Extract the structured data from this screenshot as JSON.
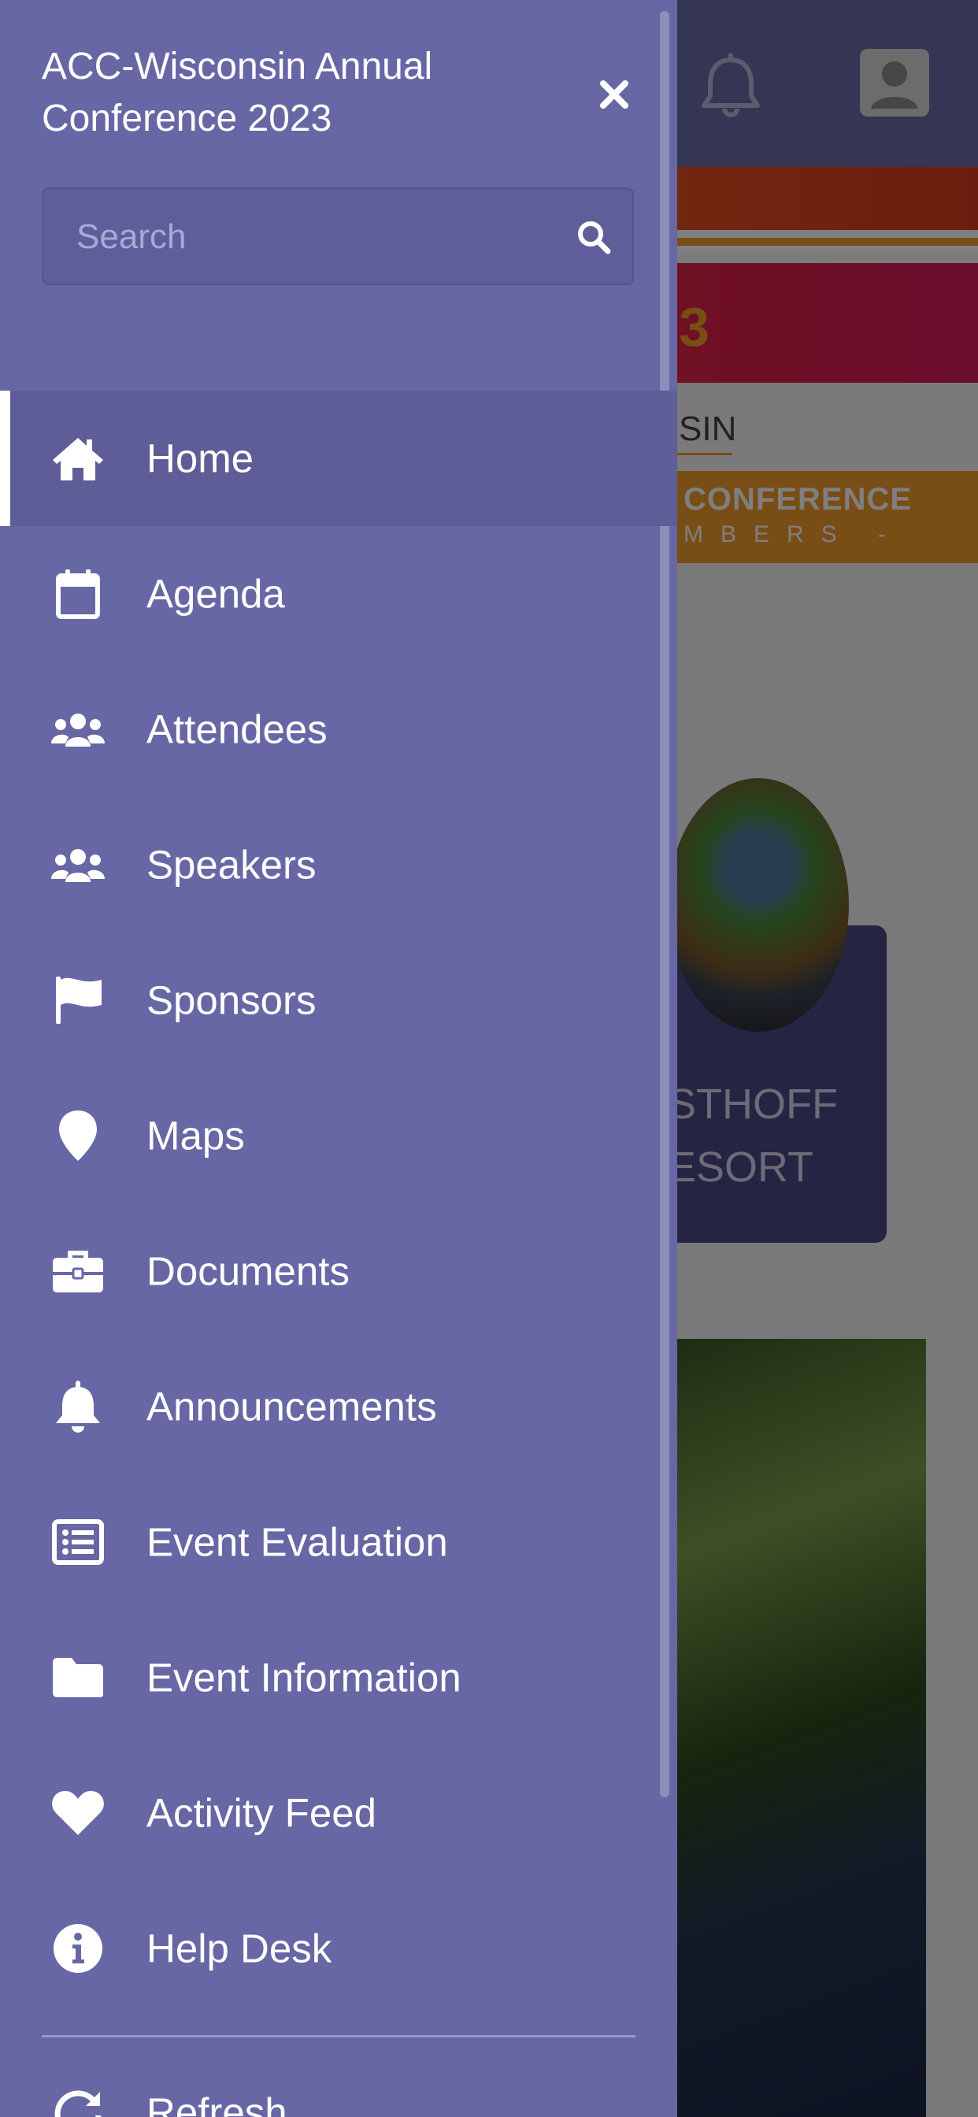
{
  "background": {
    "year_fragment": "3",
    "state_fragment": "SIN",
    "conference_fragment": "CONFERENCE",
    "members_fragment": "MBERS -",
    "venue_line1": "STHOFF",
    "venue_line2": "ESORT"
  },
  "drawer": {
    "title": "ACC-Wisconsin Annual Conference 2023",
    "search": {
      "placeholder": "Search",
      "value": ""
    },
    "menu": [
      {
        "label": "Home",
        "icon": "home-icon",
        "active": true
      },
      {
        "label": "Agenda",
        "icon": "calendar-icon",
        "active": false
      },
      {
        "label": "Attendees",
        "icon": "users-icon",
        "active": false
      },
      {
        "label": "Speakers",
        "icon": "users-icon",
        "active": false
      },
      {
        "label": "Sponsors",
        "icon": "flag-icon",
        "active": false
      },
      {
        "label": "Maps",
        "icon": "map-marker-icon",
        "active": false
      },
      {
        "label": "Documents",
        "icon": "briefcase-icon",
        "active": false
      },
      {
        "label": "Announcements",
        "icon": "bell-icon",
        "active": false
      },
      {
        "label": "Event Evaluation",
        "icon": "list-icon",
        "active": false
      },
      {
        "label": "Event Information",
        "icon": "folder-icon",
        "active": false
      },
      {
        "label": "Activity Feed",
        "icon": "heart-icon",
        "active": false
      },
      {
        "label": "Help Desk",
        "icon": "info-icon",
        "active": false
      }
    ],
    "partial_item": {
      "label": "Refresh",
      "icon": "refresh-icon"
    }
  },
  "colors": {
    "drawer_bg": "#6867a5",
    "active_item_bg": "#5e5d98",
    "accent_orange": "#f39a2c"
  }
}
